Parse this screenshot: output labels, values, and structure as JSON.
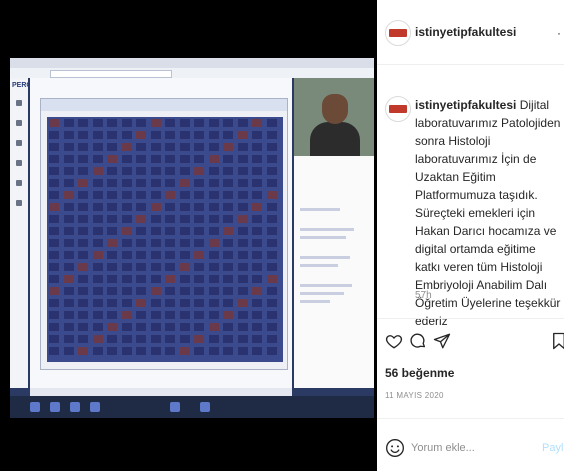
{
  "header": {
    "username": "istinyetipfakultesi",
    "more_label": "·"
  },
  "post": {
    "author": "istinyetipfakultesi",
    "caption": "Dijital laboratuvarımız Patolojiden sonra Histoloji laboratuvarımız İçin de Uzaktan Eğitim Platformumuza taşıdık. Süreçteki emekleri için Hakan Darıcı hocamıza ve digital ortamda eğitime katkı veren tüm Histoloji Embriyoloji Anabilim Dalı Öğretim Üyelerine teşekkür ederiz",
    "time_ago": "57h",
    "likes": "56 beğenme",
    "date": "11 MAYIS 2020"
  },
  "actions": {
    "like_icon": "heart-icon",
    "comment_icon": "comment-icon",
    "share_icon": "paper-plane-icon",
    "save_icon": "bookmark-icon"
  },
  "comment": {
    "placeholder": "Yorum ekle...",
    "post_label": "Payl",
    "emoji_icon": "smiley-icon"
  },
  "photo": {
    "app_label": "PERC"
  },
  "colors": {
    "brand": "#c0392b",
    "muted": "#8e8e8e",
    "link_disabled": "#b2dffc"
  }
}
